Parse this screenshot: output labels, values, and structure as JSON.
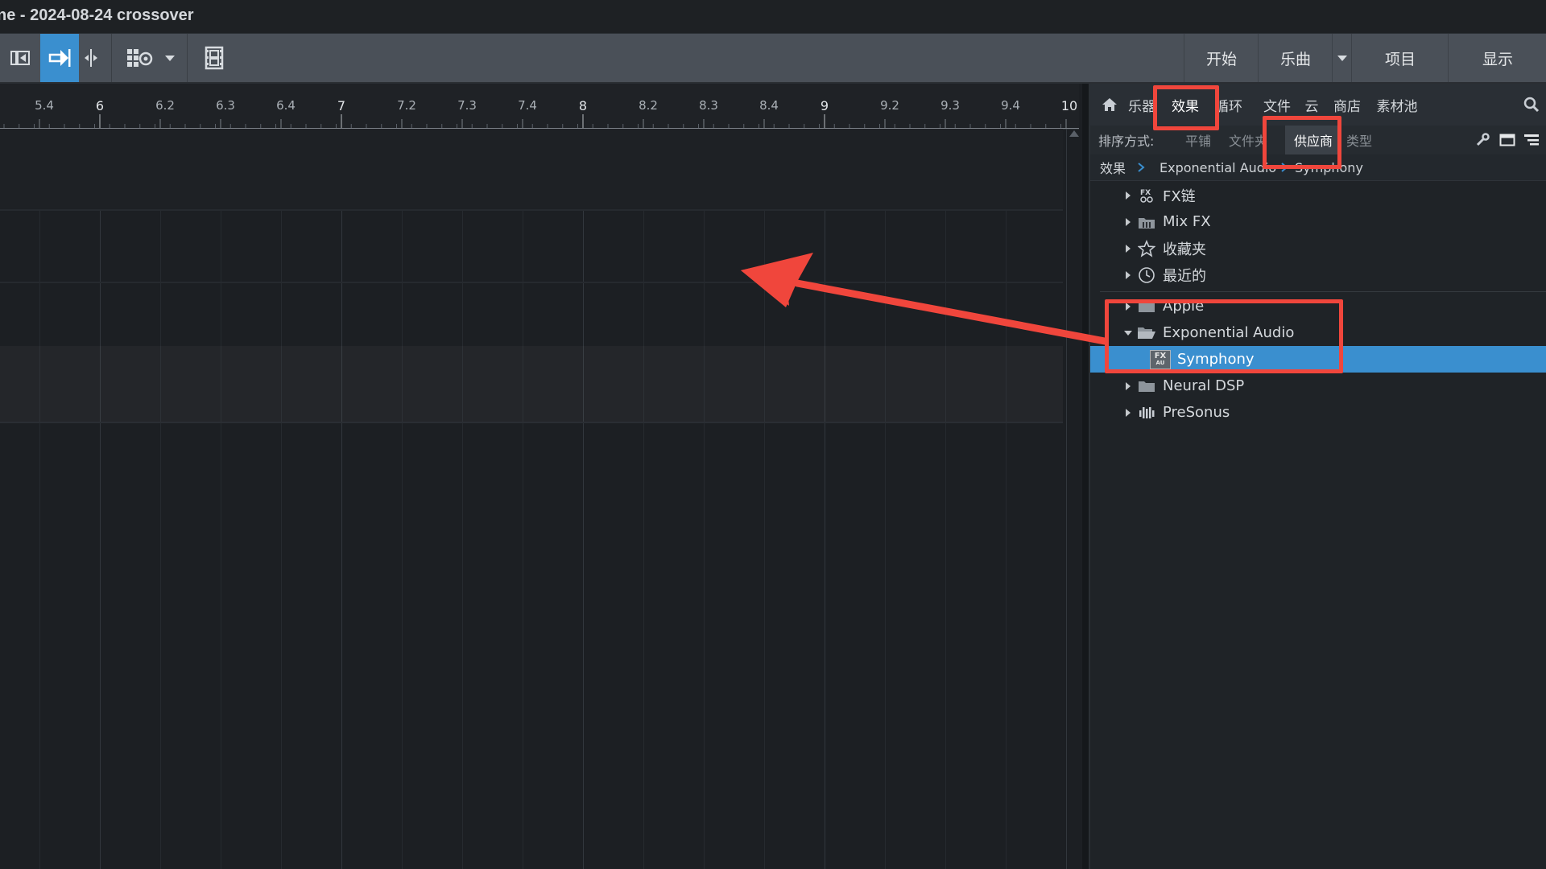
{
  "window": {
    "title": "ne - 2024-08-24 crossover"
  },
  "toolbar": {
    "nav_buttons": [
      "开始",
      "乐曲",
      "项目",
      "显示"
    ]
  },
  "ruler": {
    "labels": [
      "5.4",
      "6",
      "6.2",
      "6.3",
      "6.4",
      "7",
      "7.2",
      "7.3",
      "7.4",
      "8",
      "8.2",
      "8.3",
      "8.4",
      "9",
      "9.2",
      "9.3",
      "9.4",
      "10"
    ],
    "major": [
      "6",
      "7",
      "8",
      "9",
      "10"
    ]
  },
  "browser": {
    "tabs": [
      "乐器",
      "效果",
      "循环",
      "文件",
      "云",
      "商店",
      "素材池"
    ],
    "active_tab": "效果",
    "sort_label": "排序方式:",
    "sort_options": [
      "平铺",
      "文件夹",
      "供应商",
      "类型"
    ],
    "active_sort": "供应商",
    "breadcrumb": [
      "效果",
      "Exponential Audio",
      "Symphony"
    ],
    "tree": [
      {
        "label": "FX链",
        "icon": "fx-chain-icon",
        "expander": "collapsed"
      },
      {
        "label": "Mix FX",
        "icon": "mix-fx-icon",
        "expander": "collapsed"
      },
      {
        "label": "收藏夹",
        "icon": "star-icon",
        "expander": "collapsed"
      },
      {
        "label": "最近的",
        "icon": "clock-icon",
        "expander": "collapsed"
      },
      {
        "label": "Apple",
        "icon": "folder-icon",
        "expander": "collapsed"
      },
      {
        "label": "Exponential Audio",
        "icon": "folder-open-icon",
        "expander": "expanded"
      },
      {
        "label": "Symphony",
        "icon": "fx-au-icon",
        "expander": "none",
        "selected": true
      },
      {
        "label": "Neural DSP",
        "icon": "folder-icon",
        "expander": "collapsed"
      },
      {
        "label": "PreSonus",
        "icon": "presonus-icon",
        "expander": "collapsed"
      }
    ],
    "fx_badge_top": "FX",
    "fx_badge_bottom": "AU"
  },
  "colors": {
    "accent_blue": "#3a8fcf",
    "callout_red": "#f0463c",
    "toolbar_bg": "#4a5058"
  }
}
